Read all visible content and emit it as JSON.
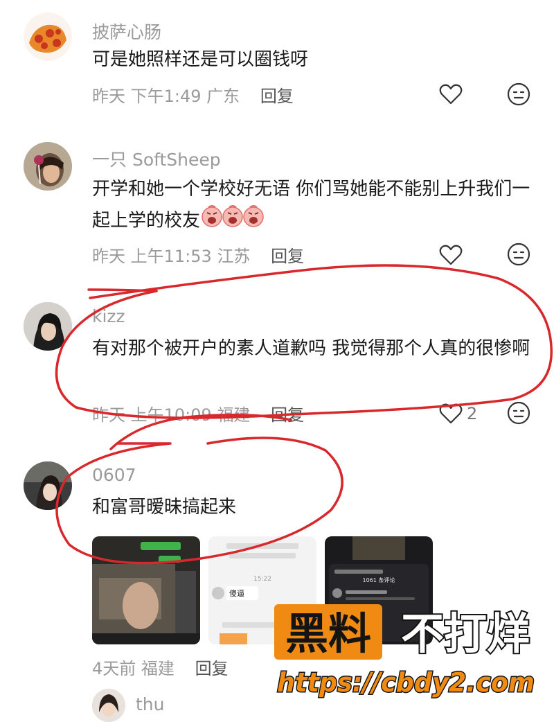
{
  "comments": [
    {
      "username": "披萨心肠",
      "text": "可是她照样还是可以圈钱呀",
      "time": "昨天 下午1:49",
      "location": "广东",
      "reply_label": "回复"
    },
    {
      "username": "一只 SoftSheep",
      "text": "开学和她一个学校好无语 你们骂她能不能别上升我们一起上学的校友",
      "time": "昨天 上午11:53",
      "location": "江苏",
      "reply_label": "回复"
    },
    {
      "username": "kizz",
      "text": "有对那个被开户的素人道歉吗 我觉得那个人真的很惨啊",
      "time": "昨天 上午10:09",
      "location": "福建",
      "reply_label": "回复",
      "like_count": "2"
    },
    {
      "username": "0607",
      "text": "和富哥暧昧搞起来",
      "time": "4天前",
      "location": "福建",
      "reply_label": "回复"
    },
    {
      "username": "thu"
    }
  ],
  "thumbnails": {
    "chat_name": "傻逼",
    "chat_time": "15:22",
    "comments_count": "1061 条评论"
  },
  "watermark": {
    "brand_a": "黑料",
    "brand_b": "不打烊",
    "url": "https://cbdy2.com"
  },
  "colors": {
    "annotation": "#d8282c",
    "watermark_orange": "#f08a12",
    "meta_gray": "#9a9a9a"
  },
  "icons": [
    "heart-icon",
    "emoji-icon",
    "crying-emoji"
  ]
}
